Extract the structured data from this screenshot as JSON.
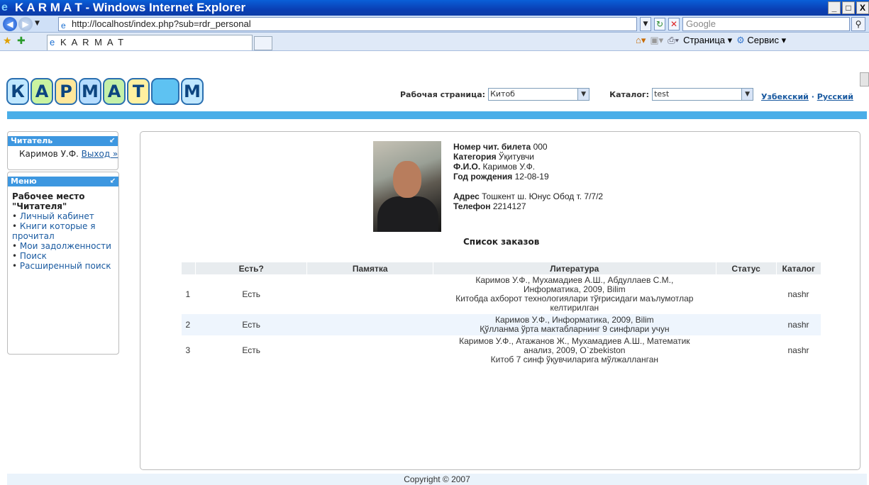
{
  "window": {
    "title": "K A R M A T - Windows Internet Explorer",
    "minimize": "_",
    "maximize": "□",
    "close": "X"
  },
  "browser": {
    "url": "http://localhost/index.php?sub=rdr_personal",
    "search_placeholder": "Google",
    "tab_title": "K A R M A T",
    "page_menu": "Страница",
    "tools_menu": "Сервис"
  },
  "site": {
    "logo_letters": [
      "К",
      "А",
      "Р",
      "М",
      "А",
      "Т",
      "",
      "М"
    ],
    "work_page_label": "Рабочая страница:",
    "work_page_value": "Китоб",
    "catalog_label": "Каталог:",
    "catalog_value": "test",
    "lang_uz": "Узбекский",
    "lang_sep": "·",
    "lang_ru": "Русский"
  },
  "sidebar": {
    "reader_title": "Читатель",
    "reader_name": "Каримов У.Ф.",
    "logout": "Выход »",
    "menu_title": "Меню",
    "workplace_title_1": "Рабочее место",
    "workplace_title_2": "\"Читателя\"",
    "items": [
      {
        "label": "Личный кабинет"
      },
      {
        "label": "Книги которые я прочитал"
      },
      {
        "label": "Мои задолженности"
      },
      {
        "label": "Поиск"
      },
      {
        "label": "Расширенный поиск"
      }
    ]
  },
  "profile": {
    "ticket_label": "Номер чит. билета",
    "ticket_value": "000",
    "category_label": "Категория",
    "category_value": "Ўқитувчи",
    "name_label": "Ф.И.О.",
    "name_value": "Каримов У.Ф.",
    "birth_label": "Год рождения",
    "birth_value": "12-08-19",
    "address_label": "Адрес",
    "address_value": "Тошкент ш. Юнус Обод т. 7/7/2",
    "phone_label": "Телефон",
    "phone_value": "2214127"
  },
  "orders": {
    "title": "Список заказов",
    "headers": [
      "",
      "Есть?",
      "Памятка",
      "Литература",
      "Статус",
      "Каталог"
    ],
    "rows": [
      {
        "num": "1",
        "available": "Есть",
        "memo": "",
        "literature": [
          "Каримов У.Ф., Мухамадиев А.Ш., Абдуллаев С.М.,",
          "Информатика, 2009, Bilim",
          "Китобда ахборот технологиялари тўғрисидаги маълумотлар",
          "келтирилган"
        ],
        "status": "",
        "catalog": "nashr"
      },
      {
        "num": "2",
        "available": "Есть",
        "memo": "",
        "literature": [
          "Каримов У.Ф., Информатика, 2009, Bilim",
          "Қўлланма ўрта мактабларнинг 9 синфлари учун"
        ],
        "status": "",
        "catalog": "nashr"
      },
      {
        "num": "3",
        "available": "Есть",
        "memo": "",
        "literature": [
          "Каримов У.Ф., Атажанов Ж., Мухамадиев А.Ш., Математик",
          "анализ, 2009, O`zbekiston",
          "Китоб 7 синф ўқувчиларига мўлжалланган"
        ],
        "status": "",
        "catalog": "nashr"
      }
    ]
  },
  "footer": {
    "copyright": "Copyright © 2007"
  }
}
